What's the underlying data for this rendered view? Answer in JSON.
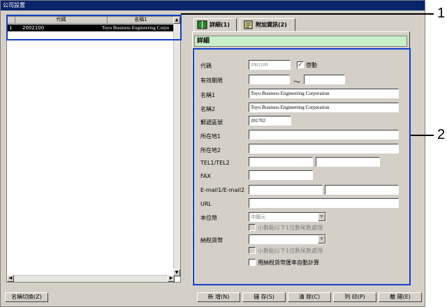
{
  "window": {
    "title": "公司設置"
  },
  "list": {
    "columns": [
      "代碼",
      "名稱1"
    ],
    "rows": [
      {
        "num": "1",
        "code": "2002100",
        "name": "Toyo Business Engineering Corpo"
      }
    ]
  },
  "tabs": [
    {
      "label": "詳細(1)"
    },
    {
      "label": "附加資訊(2)"
    }
  ],
  "detail": {
    "header": "詳細",
    "code_label": "代碼",
    "code_value": "2002100",
    "active_label": "啓動",
    "active_checked": "✓",
    "valid_label": "有效期限",
    "valid_from": "",
    "valid_tilde": "～",
    "valid_to": "",
    "name1_label": "名稱1",
    "name1_value": "Toyo Business Engineering Corporation",
    "name2_label": "名稱2",
    "name2_value": "Toyo Business Engineering Corporation",
    "zip_label": "郵遞區號",
    "zip_value": "201702",
    "addr1_label": "所在地1",
    "addr1_value": "",
    "addr2_label": "所在地2",
    "addr2_value": "",
    "tel_label": "TEL1/TEL2",
    "tel1_value": "",
    "tel2_value": "",
    "fax_label": "FAX",
    "fax_value": "",
    "email_label": "E-mail1/E-mail2",
    "email1_value": "",
    "email2_value": "",
    "url_label": "URL",
    "url_value": "",
    "currency_label": "本位幣",
    "currency_value": "中國元",
    "currency_round_label": "小數點以下1位數尾數處理",
    "tax_currency_label": "納稅貨幣",
    "tax_currency_value": "",
    "tax_round_label": "小數點以下1位數尾數處理",
    "auto_calc_label": "用納稅貨幣匯率自動計算"
  },
  "buttons": {
    "name_switch": "名稱切換(Z)",
    "add": "新 增(N)",
    "save": "儲 存(S)",
    "clear": "清 除(C)",
    "print": "列 印(P)",
    "close": "離 開(E)"
  },
  "callouts": [
    "1",
    "2"
  ],
  "colors": {
    "highlight": "#1240c8",
    "titlebar": "#0a246a",
    "detail_header": "#c8f0c8"
  }
}
